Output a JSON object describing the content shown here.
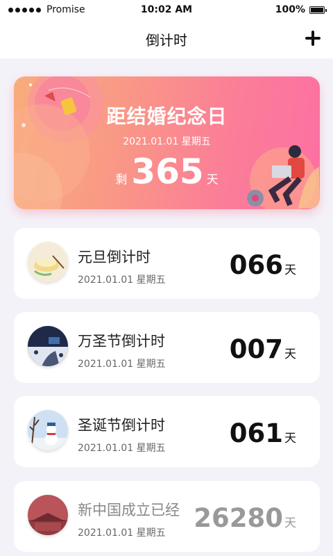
{
  "status_bar": {
    "carrier": "Promise",
    "time": "10:02 AM",
    "battery": "100%"
  },
  "nav": {
    "title": "倒计时",
    "add_icon": "plus-icon"
  },
  "hero": {
    "title": "距结婚纪念日",
    "date": "2021.01.01  星期五",
    "prefix": "剩",
    "count": "365",
    "unit": "天"
  },
  "events": [
    {
      "name": "元旦倒计时",
      "date": "2021.01.01  星期五",
      "count": "066",
      "unit": "天"
    },
    {
      "name": "万圣节倒计时",
      "date": "2021.01.01  星期五",
      "count": "007",
      "unit": "天"
    },
    {
      "name": "圣诞节倒计时",
      "date": "2021.01.01  星期五",
      "count": "061",
      "unit": "天"
    },
    {
      "name": "新中国成立已经",
      "date": "2021.01.01  星期五",
      "count": "26280",
      "unit": "天"
    }
  ],
  "colors": {
    "hero_start": "#f8ad7c",
    "hero_end": "#fc6fa3",
    "background": "#f4f2f9"
  }
}
